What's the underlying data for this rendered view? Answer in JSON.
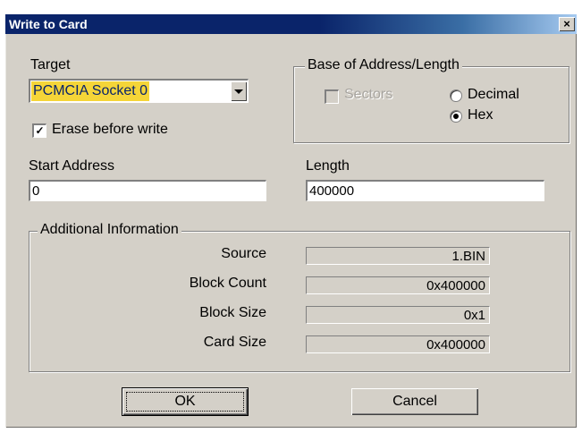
{
  "window": {
    "title": "Write to Card",
    "close_glyph": "×"
  },
  "target": {
    "label": "Target",
    "selected": "PCMCIA Socket 0",
    "erase_label": "Erase before write",
    "erase_checked": true
  },
  "base": {
    "group_title": "Base of Address/Length",
    "sectors_label": "Sectors",
    "sectors_enabled": false,
    "decimal_label": "Decimal",
    "hex_label": "Hex",
    "selected": "Hex"
  },
  "start_address": {
    "label": "Start Address",
    "value": "0"
  },
  "length": {
    "label": "Length",
    "value": "400000"
  },
  "info": {
    "group_title": "Additional Information",
    "rows": [
      {
        "label": "Source",
        "value": "1.BIN"
      },
      {
        "label": "Block Count",
        "value": "0x400000"
      },
      {
        "label": "Block Size",
        "value": "0x1"
      },
      {
        "label": "Card Size",
        "value": "0x400000"
      }
    ]
  },
  "buttons": {
    "ok": "OK",
    "cancel": "Cancel"
  }
}
